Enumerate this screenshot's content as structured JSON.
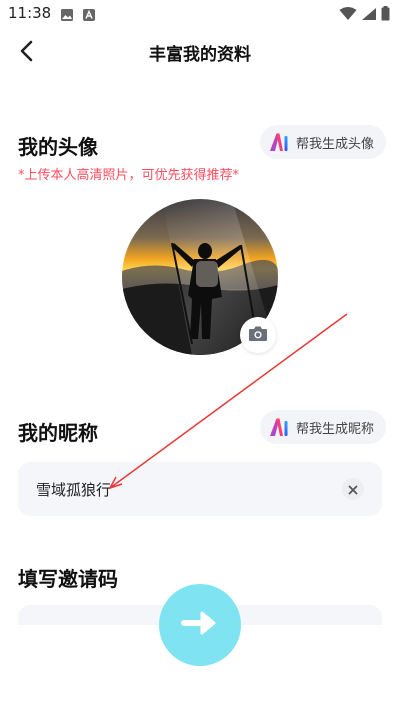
{
  "status_bar": {
    "time": "11:38",
    "icons": [
      "image-icon",
      "app-icon",
      "wifi-icon",
      "signal-icon",
      "battery-icon"
    ]
  },
  "header": {
    "title": "丰富我的资料"
  },
  "avatar_section": {
    "title": "我的头像",
    "ai_button_label": "帮我生成头像",
    "hint": "*上传本人高清照片，可优先获得推荐*"
  },
  "nickname_section": {
    "title": "我的昵称",
    "ai_button_label": "帮我生成昵称",
    "value": "雪域孤狼行"
  },
  "invite_section": {
    "title": "填写邀请码",
    "value": ""
  },
  "colors": {
    "accent": "#7fe3f2",
    "hint_red": "#ff4d5e",
    "annotation_red": "#e53935"
  }
}
